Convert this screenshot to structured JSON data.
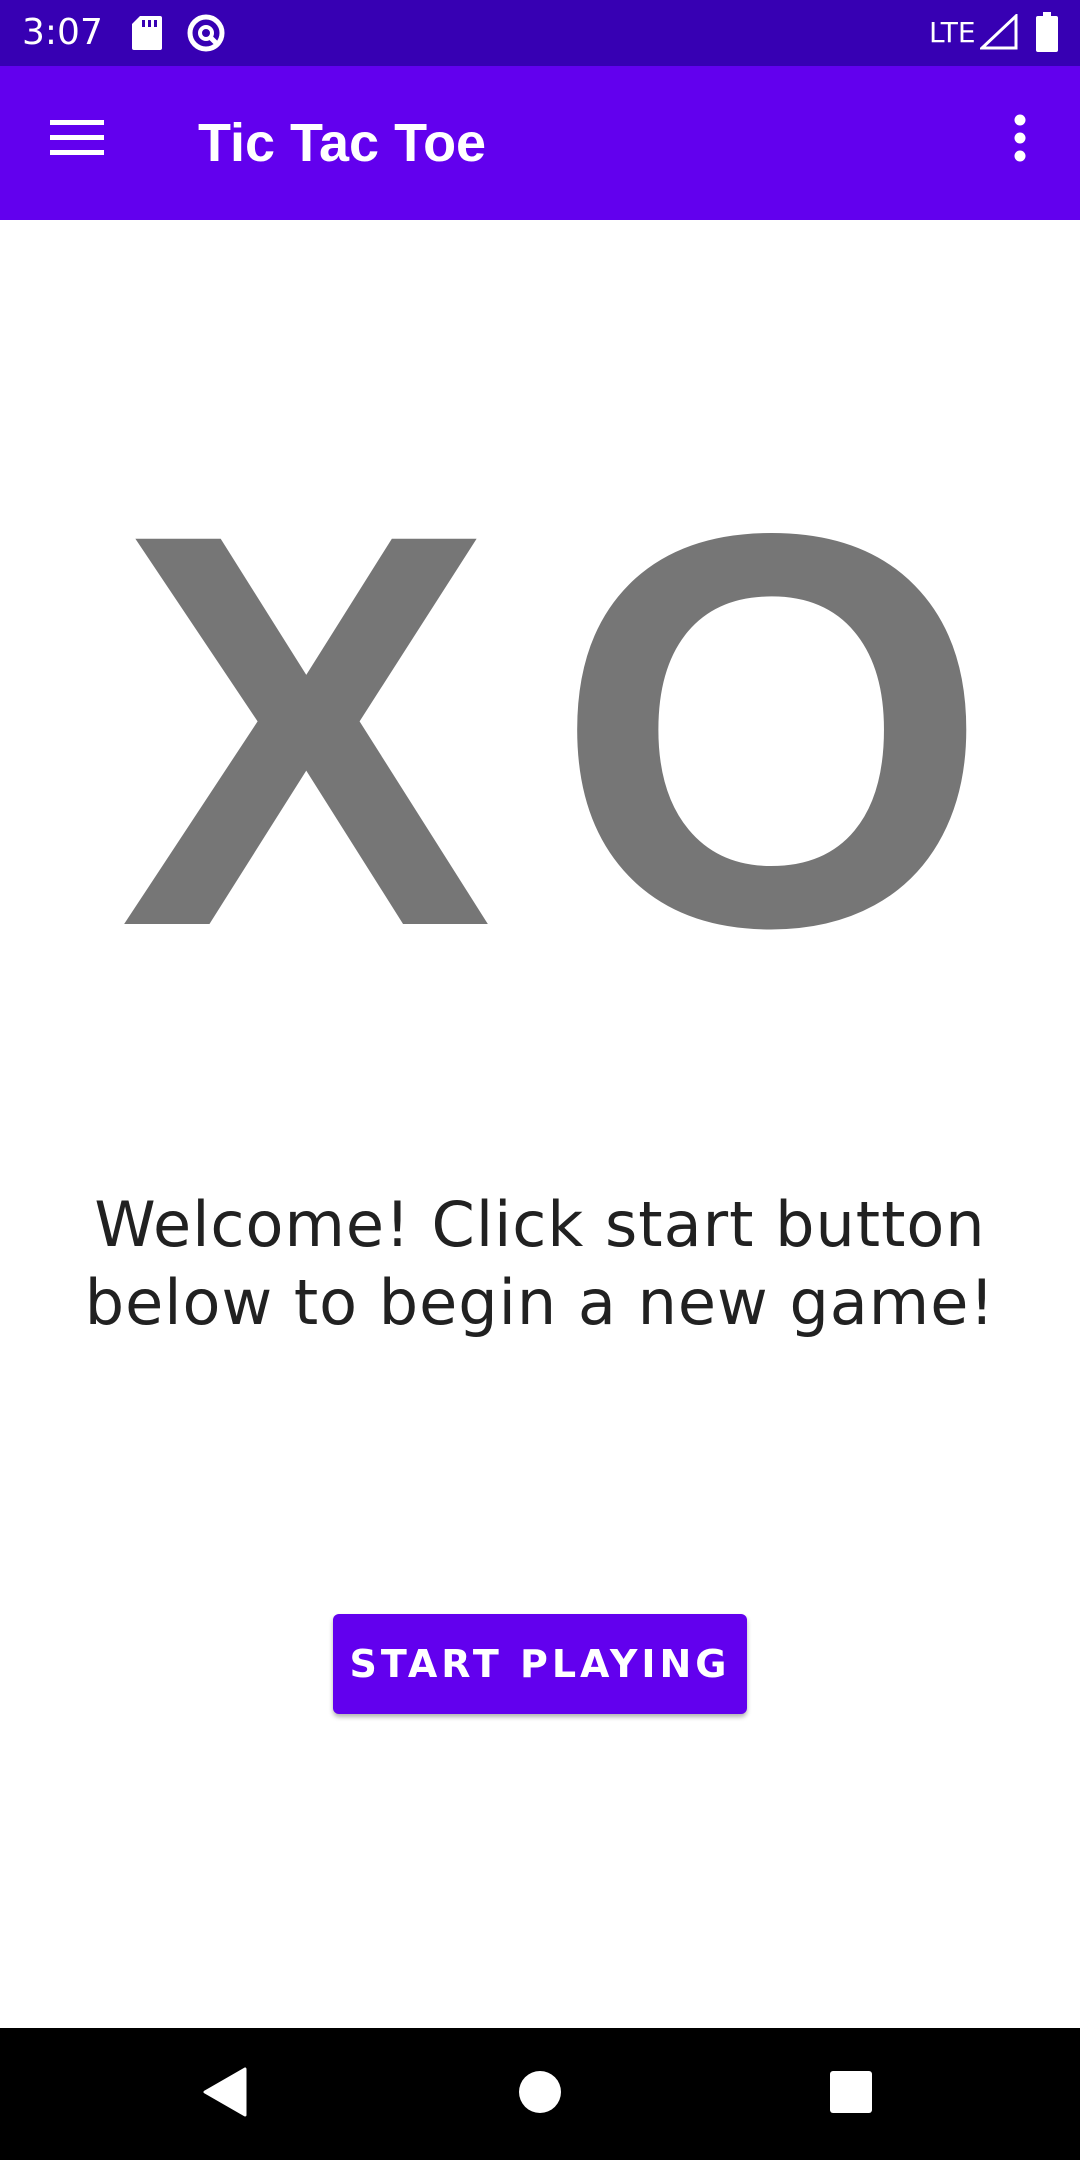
{
  "status_bar": {
    "time": "3:07",
    "network": "LTE",
    "icons": [
      "sd-card-icon",
      "sync-icon",
      "signal-icon",
      "battery-icon"
    ]
  },
  "app_bar": {
    "title": "Tic Tac Toe",
    "menu_icon": "hamburger-menu-icon",
    "overflow_icon": "more-vert-icon",
    "color": "#6200ee"
  },
  "logo": {
    "text_x": "X",
    "text_o": "O",
    "color": "#767676"
  },
  "main": {
    "welcome_text": "Welcome! Click start button below to begin a new game!",
    "start_button_label": "START PLAYING"
  },
  "nav_bar": {
    "icons": [
      "back-icon",
      "home-icon",
      "recents-icon"
    ]
  },
  "colors": {
    "status_bar": "#3700b3",
    "primary": "#6200ee",
    "text": "#212121"
  }
}
